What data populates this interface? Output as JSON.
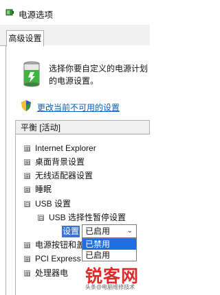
{
  "window": {
    "title": "电源选项"
  },
  "tabs": [
    {
      "label": "高级设置"
    }
  ],
  "description": {
    "line1": "选择你要自定义的电源计划",
    "line2": "的电源设置。"
  },
  "change_link": "更改当前不可用的设置",
  "plan": {
    "selected": "平衡 [活动]"
  },
  "tree": {
    "items": [
      {
        "label": "Internet Explorer",
        "expander": "⊞"
      },
      {
        "label": "桌面背景设置",
        "expander": "⊞"
      },
      {
        "label": "无线适配器设置",
        "expander": "⊞"
      },
      {
        "label": "睡眠",
        "expander": "⊞"
      },
      {
        "label": "USB 设置",
        "expander": "⊟"
      },
      {
        "label": "USB 选择性暂停设置",
        "expander": "⊟"
      },
      {
        "label": "电源按钮和盖",
        "expander": "⊞"
      },
      {
        "label": "PCI Express",
        "expander": "⊞"
      },
      {
        "label": "处理器电",
        "expander": "⊞"
      }
    ],
    "setting_label": "设置",
    "combo_value": "已启用",
    "options": [
      "已禁用",
      "已启用"
    ]
  },
  "watermark": {
    "text": "锐客网",
    "subtext": "头条@电脑维修技术"
  },
  "colors": {
    "link": "#0b5cb8",
    "selection": "#1f6fe0",
    "label_highlight": "#3b73d4",
    "watermark": "#e02a2a"
  }
}
